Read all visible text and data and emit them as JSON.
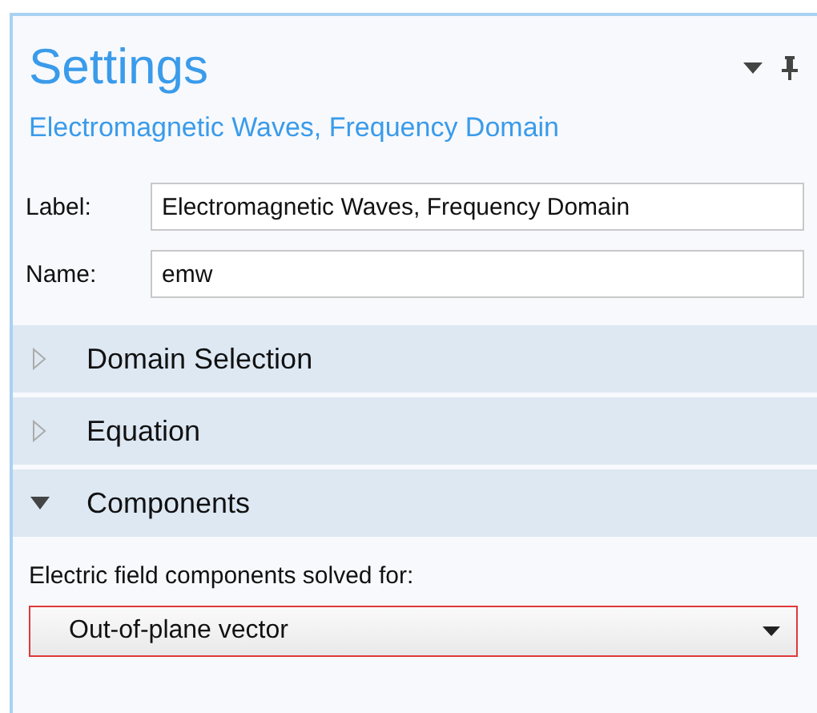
{
  "panel": {
    "title": "Settings",
    "subtitle": "Electromagnetic Waves, Frequency Domain"
  },
  "fields": [
    {
      "label": "Label:",
      "value": "Electromagnetic Waves, Frequency Domain"
    },
    {
      "label": "Name:",
      "value": "emw"
    }
  ],
  "sections": [
    {
      "title": "Domain Selection",
      "expanded": false
    },
    {
      "title": "Equation",
      "expanded": false
    },
    {
      "title": "Components",
      "expanded": true
    }
  ],
  "components": {
    "label": "Electric field components solved for:",
    "value": "Out-of-plane vector"
  }
}
